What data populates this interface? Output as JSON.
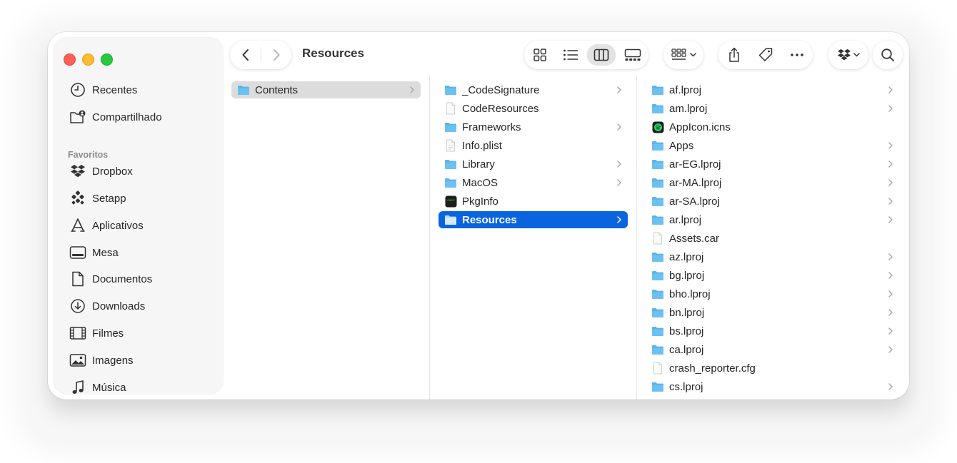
{
  "toolbar": {
    "title": "Resources"
  },
  "sidebar": {
    "top": [
      {
        "label": "Recentes",
        "icon": "clock-icon"
      },
      {
        "label": "Compartilhado",
        "icon": "shared-folder-icon"
      }
    ],
    "favorites_heading": "Favoritos",
    "favorites": [
      {
        "label": "Dropbox",
        "icon": "dropbox-icon"
      },
      {
        "label": "Setapp",
        "icon": "setapp-icon"
      },
      {
        "label": "Aplicativos",
        "icon": "applications-icon"
      },
      {
        "label": "Mesa",
        "icon": "desktop-icon"
      },
      {
        "label": "Documentos",
        "icon": "document-icon"
      },
      {
        "label": "Downloads",
        "icon": "download-icon"
      },
      {
        "label": "Filmes",
        "icon": "film-icon"
      },
      {
        "label": "Imagens",
        "icon": "photo-icon"
      },
      {
        "label": "Música",
        "icon": "music-icon"
      }
    ]
  },
  "columns": {
    "col1": [
      {
        "label": "Contents",
        "kind": "folder",
        "chevron": true,
        "state": "selected-inactive"
      }
    ],
    "col2": [
      {
        "label": "_CodeSignature",
        "kind": "folder",
        "chevron": true
      },
      {
        "label": "CodeResources",
        "kind": "file",
        "chevron": false
      },
      {
        "label": "Frameworks",
        "kind": "folder",
        "chevron": true
      },
      {
        "label": "Info.plist",
        "kind": "plist",
        "chevron": false
      },
      {
        "label": "Library",
        "kind": "folder",
        "chevron": true
      },
      {
        "label": "MacOS",
        "kind": "folder",
        "chevron": true
      },
      {
        "label": "PkgInfo",
        "kind": "exec",
        "chevron": false
      },
      {
        "label": "Resources",
        "kind": "folder",
        "chevron": true,
        "state": "selected-active"
      }
    ],
    "col3": [
      {
        "label": "af.lproj",
        "kind": "folder",
        "chevron": true
      },
      {
        "label": "am.lproj",
        "kind": "folder",
        "chevron": true
      },
      {
        "label": "AppIcon.icns",
        "kind": "icns",
        "chevron": false
      },
      {
        "label": "Apps",
        "kind": "folder",
        "chevron": true
      },
      {
        "label": "ar-EG.lproj",
        "kind": "folder",
        "chevron": true
      },
      {
        "label": "ar-MA.lproj",
        "kind": "folder",
        "chevron": true
      },
      {
        "label": "ar-SA.lproj",
        "kind": "folder",
        "chevron": true
      },
      {
        "label": "ar.lproj",
        "kind": "folder",
        "chevron": true
      },
      {
        "label": "Assets.car",
        "kind": "file",
        "chevron": false
      },
      {
        "label": "az.lproj",
        "kind": "folder",
        "chevron": true
      },
      {
        "label": "bg.lproj",
        "kind": "folder",
        "chevron": true
      },
      {
        "label": "bho.lproj",
        "kind": "folder",
        "chevron": true
      },
      {
        "label": "bn.lproj",
        "kind": "folder",
        "chevron": true
      },
      {
        "label": "bs.lproj",
        "kind": "folder",
        "chevron": true
      },
      {
        "label": "ca.lproj",
        "kind": "folder",
        "chevron": true
      },
      {
        "label": "crash_reporter.cfg",
        "kind": "file",
        "chevron": false
      },
      {
        "label": "cs.lproj",
        "kind": "folder",
        "chevron": true
      }
    ]
  },
  "colors": {
    "folder": "#5ab4ea",
    "selection_active": "#0a64e0",
    "selection_inactive": "#dcdcdc",
    "traffic_red": "#ff5f57",
    "traffic_yellow": "#febc2e",
    "traffic_green": "#28c840"
  }
}
